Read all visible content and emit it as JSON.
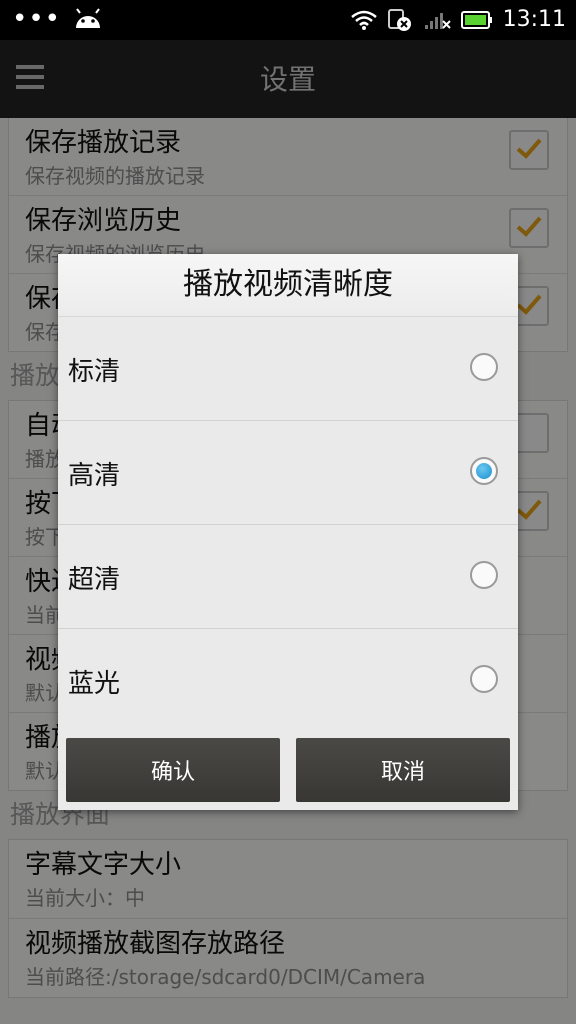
{
  "status_bar": {
    "time": "13:11",
    "icons": [
      "more-dots-icon",
      "android-icon",
      "wifi-icon",
      "sim-error-icon",
      "signal-icon",
      "battery-icon"
    ]
  },
  "app_bar": {
    "title": "设置"
  },
  "settings": {
    "group1": [
      {
        "title": "保存播放记录",
        "subtitle": "保存视频的播放记录",
        "checked": true
      },
      {
        "title": "保存浏览历史",
        "subtitle": "保存视频的浏览历史",
        "checked": true
      },
      {
        "title": "保存",
        "subtitle": "保存",
        "checked": true
      }
    ],
    "section_play": "播放",
    "group2": [
      {
        "title": "自动",
        "subtitle": "播放",
        "checked": false
      },
      {
        "title": "按下",
        "subtitle": "按下",
        "checked": true
      },
      {
        "title": "快进",
        "subtitle": "当前"
      },
      {
        "title": "视频",
        "subtitle": "默认"
      },
      {
        "title": "播放",
        "subtitle": "默认"
      }
    ],
    "section_ui": "播放界面",
    "group3": [
      {
        "title": "字幕文字大小",
        "subtitle": "当前大小：中"
      },
      {
        "title": "视频播放截图存放路径",
        "subtitle": "当前路径:/storage/sdcard0/DCIM/Camera"
      }
    ]
  },
  "dialog": {
    "title": "播放视频清晰度",
    "options": [
      {
        "label": "标清",
        "selected": false
      },
      {
        "label": "高清",
        "selected": true
      },
      {
        "label": "超清",
        "selected": false
      },
      {
        "label": "蓝光",
        "selected": false
      }
    ],
    "confirm_label": "确认",
    "cancel_label": "取消"
  },
  "colors": {
    "accent_check": "#e8a317",
    "radio_selected": "#1b8fd1",
    "app_bar": "#242424"
  }
}
